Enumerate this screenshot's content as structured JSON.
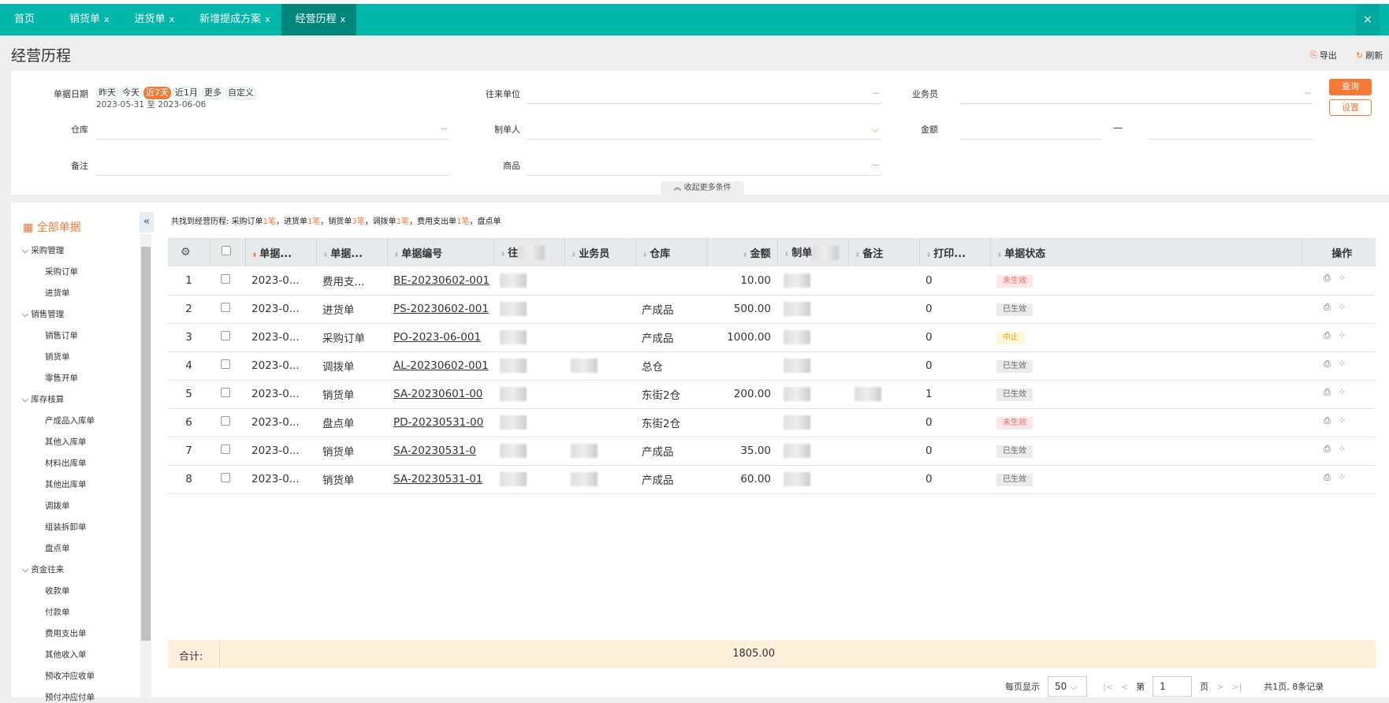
{
  "tabs": [
    {
      "label": "首页",
      "closable": false
    },
    {
      "label": "销货单",
      "closable": true
    },
    {
      "label": "进货单",
      "closable": true
    },
    {
      "label": "新增提成方案",
      "closable": true
    },
    {
      "label": "经营历程",
      "closable": true,
      "active": true
    }
  ],
  "tab_close": "×",
  "page": {
    "title": "经营历程",
    "export": "导出",
    "refresh": "刷新"
  },
  "filters": {
    "date_label": "单据日期",
    "date_chips": [
      "昨天",
      "今天",
      "近7天",
      "近1月",
      "更多",
      "自定义"
    ],
    "date_selected": "近7天",
    "date_range": "2023-05-31 至 2023-06-06",
    "partner_label": "往来单位",
    "salesman_label": "业务员",
    "warehouse_label": "仓库",
    "creator_label": "制单人",
    "amount_label": "金额",
    "amount_sep": "—",
    "remark_label": "备注",
    "product_label": "商品",
    "dots": "···",
    "query": "查询",
    "settings": "设置",
    "collapse": "收起更多条件"
  },
  "sidebar": {
    "title": "全部单据",
    "collapse_icon": "«",
    "groups": [
      {
        "label": "采购管理",
        "items": [
          "采购订单",
          "进货单"
        ]
      },
      {
        "label": "销售管理",
        "items": [
          "销售订单",
          "销货单",
          "零售开单"
        ]
      },
      {
        "label": "库存核算",
        "items": [
          "产成品入库单",
          "其他入库单",
          "材料出库单",
          "其他出库单",
          "调拨单",
          "组装拆卸单",
          "盘点单"
        ]
      },
      {
        "label": "资金往来",
        "items": [
          "收款单",
          "付款单",
          "费用支出单",
          "其他收入单",
          "预收冲应收单",
          "预付冲应付单"
        ]
      }
    ]
  },
  "summary": {
    "prefix": "共找到经营历程: ",
    "parts": [
      {
        "t": "采购订单",
        "n": "1笔"
      },
      {
        "t": "进货单",
        "n": "1笔"
      },
      {
        "t": "销货单",
        "n": "3笔"
      },
      {
        "t": "调拨单",
        "n": "1笔"
      },
      {
        "t": "费用支出单",
        "n": "1笔"
      },
      {
        "t": "盘点单",
        "n": ""
      }
    ]
  },
  "table": {
    "columns": [
      "",
      "",
      "单据...",
      "单据...",
      "单据编号",
      "往",
      "业务员",
      "仓库",
      "金额",
      "制单",
      "备注",
      "打印...",
      "单据状态",
      "操作"
    ],
    "rows": [
      {
        "no": "1",
        "date": "2023-0...",
        "type": "费用支...",
        "code": "BE-20230602-001",
        "warehouse": "",
        "amount": "10.00",
        "print": "0",
        "status": "未生效"
      },
      {
        "no": "2",
        "date": "2023-0...",
        "type": "进货单",
        "code": "PS-20230602-001",
        "warehouse": "产成品",
        "amount": "500.00",
        "print": "0",
        "status": "已生效"
      },
      {
        "no": "3",
        "date": "2023-0...",
        "type": "采购订单",
        "code": "PO-2023-06-001",
        "warehouse": "产成品",
        "amount": "1000.00",
        "print": "0",
        "status": "中止"
      },
      {
        "no": "4",
        "date": "2023-0...",
        "type": "调拨单",
        "code": "AL-20230602-001",
        "warehouse": "总仓",
        "amount": "",
        "print": "0",
        "status": "已生效"
      },
      {
        "no": "5",
        "date": "2023-0...",
        "type": "销货单",
        "code": "SA-20230601-00",
        "warehouse": "东街2仓",
        "amount": "200.00",
        "print": "1",
        "status": "已生效"
      },
      {
        "no": "6",
        "date": "2023-0...",
        "type": "盘点单",
        "code": "PD-20230531-00",
        "warehouse": "东街2仓",
        "amount": "",
        "print": "0",
        "status": "未生效"
      },
      {
        "no": "7",
        "date": "2023-0...",
        "type": "销货单",
        "code": "SA-20230531-0",
        "warehouse": "产成品",
        "amount": "35.00",
        "print": "0",
        "status": "已生效"
      },
      {
        "no": "8",
        "date": "2023-0...",
        "type": "销货单",
        "code": "SA-20230531-01",
        "warehouse": "产成品",
        "amount": "60.00",
        "print": "0",
        "status": "已生效"
      }
    ],
    "total_label": "合计:",
    "total_amount": "1805.00"
  },
  "status_colors": {
    "未生效": {
      "bg": "#ffe6e6",
      "fg": "#f56c6c"
    },
    "已生效": {
      "bg": "#ebebeb",
      "fg": "#666666"
    },
    "中止": {
      "bg": "#fff5d9",
      "fg": "#f5a300"
    }
  },
  "pager": {
    "per_page_label": "每页显示",
    "per_page": "50",
    "page_prefix": "第",
    "page": "1",
    "page_suffix": "页",
    "info": "共1页, 8条记录"
  },
  "colors": {
    "tabbar": "#00b7aa",
    "accent": "#f07c3c"
  }
}
